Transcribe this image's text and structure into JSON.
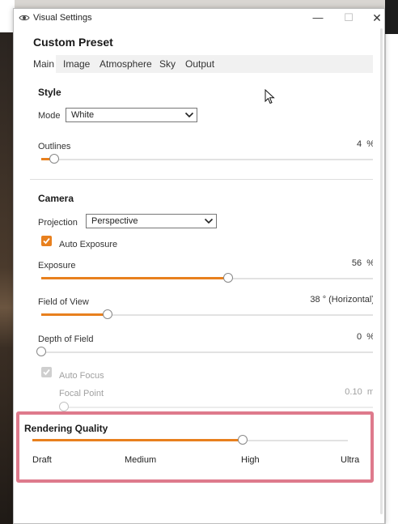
{
  "window": {
    "title": "Visual Settings",
    "minimize_glyph": "—",
    "maximize_glyph": "☐",
    "close_glyph": "✕",
    "preset_title": "Custom Preset"
  },
  "tabs": [
    {
      "label": "Main",
      "active": true
    },
    {
      "label": "Image",
      "active": false
    },
    {
      "label": "Atmosphere",
      "active": false
    },
    {
      "label": "Sky",
      "active": false
    },
    {
      "label": "Output",
      "active": false
    }
  ],
  "style": {
    "title": "Style",
    "mode_label": "Mode",
    "mode_value": "White",
    "outlines_label": "Outlines",
    "outlines_value": "4",
    "outlines_unit": "%",
    "outlines_level": 0.04
  },
  "camera": {
    "title": "Camera",
    "projection_label": "Projection",
    "projection_value": "Perspective",
    "auto_exposure_label": "Auto Exposure",
    "auto_exposure_checked": true,
    "exposure_label": "Exposure",
    "exposure_value": "56",
    "exposure_unit": "%",
    "exposure_level": 0.56,
    "fov_label": "Field of View",
    "fov_value": "38",
    "fov_unit": "° (Horizontal)",
    "fov_level": 0.2,
    "dof_label": "Depth of Field",
    "dof_value": "0",
    "dof_unit": "%",
    "dof_level": 0.0,
    "auto_focus_label": "Auto Focus",
    "auto_focus_checked": true,
    "focal_point_label": "Focal Point",
    "focal_point_value": "0.10",
    "focal_point_unit": "m",
    "focal_point_level": 0.0
  },
  "rendering_quality": {
    "title": "Rendering Quality",
    "levels": [
      "Draft",
      "Medium",
      "High",
      "Ultra"
    ],
    "selected": "High"
  },
  "icons": {
    "eye": "eye-icon",
    "chevron_down": "chevron-down-icon",
    "check": "check-icon",
    "left_chevron": "chevron-left-icon",
    "cursor": "mouse-cursor-icon"
  },
  "colors": {
    "accent": "#e8801e",
    "highlight_border": "#de7a8c",
    "disabled": "#a0a0a0"
  }
}
